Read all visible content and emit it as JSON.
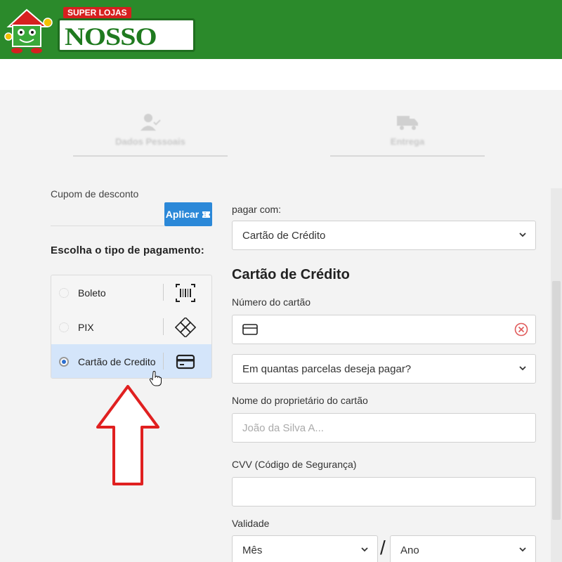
{
  "brand": {
    "tagline": "SUPER LOJAS",
    "name": "NOSSO LAR"
  },
  "steps": [
    {
      "label": "Dados Pessoais",
      "icon": "user-check-icon"
    },
    {
      "label": "Entrega",
      "icon": "truck-icon"
    }
  ],
  "coupon": {
    "label": "Cupom de desconto",
    "value": "",
    "button": "Aplicar"
  },
  "payment": {
    "title": "Escolha o tipo de pagamento:",
    "options": [
      {
        "label": "Boleto",
        "icon": "barcode-icon",
        "selected": false
      },
      {
        "label": "PIX",
        "icon": "pix-icon",
        "selected": false
      },
      {
        "label": "Cartão de Credito",
        "icon": "credit-card-icon",
        "selected": true
      }
    ]
  },
  "form": {
    "pay_with_label": "pagar com:",
    "pay_with_value": "Cartão de Crédito",
    "section_title": "Cartão de Crédito",
    "card_number_label": "Número do cartão",
    "card_number_value": "",
    "installments_value": "Em quantas parcelas deseja pagar?",
    "owner_label": "Nome do proprietário do cartão",
    "owner_placeholder": "João da Silva A...",
    "cvv_label": "CVV (Código de Segurança)",
    "cvv_value": "",
    "validity_label": "Validade",
    "month_value": "Mês",
    "separator": "/",
    "year_value": "Ano"
  },
  "colors": {
    "header_green": "#2b8a2b",
    "apply_blue": "#2b88d8",
    "selected_bg": "#d4e5fa",
    "arrow_red": "#e02020",
    "error_red": "#e05a5a"
  }
}
